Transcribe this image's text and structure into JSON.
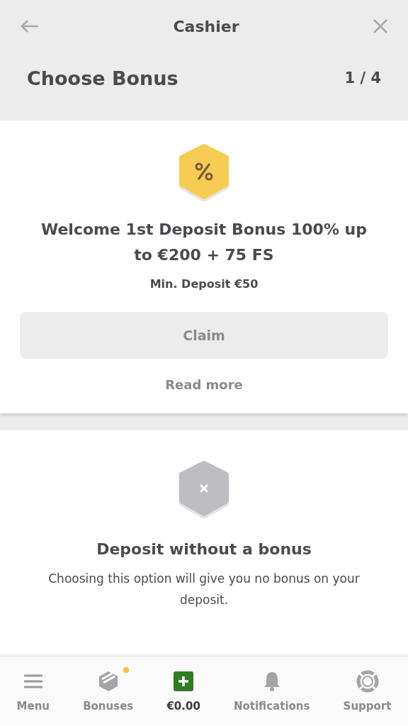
{
  "header": {
    "title": "Cashier",
    "heading": "Choose Bonus",
    "step": "1 / 4"
  },
  "options": [
    {
      "kind": "bonus",
      "title": "Welcome 1st Deposit Bonus 100% up to €200 + 75 FS",
      "subtitle": "Min. Deposit €50",
      "button": {
        "label": "Claim",
        "disabled": true
      },
      "link": "Read more"
    },
    {
      "kind": "none",
      "title": "Deposit without a bonus",
      "subtitle": "Choosing this option will give you no bonus on your deposit."
    }
  ],
  "nav": [
    {
      "label": "Menu",
      "badge": false,
      "selected": false
    },
    {
      "label": "Bonuses",
      "badge": true,
      "selected": false
    },
    {
      "label": "€0.00",
      "badge": false,
      "selected": true
    },
    {
      "label": "Notifications",
      "badge": false,
      "selected": false
    },
    {
      "label": "Support",
      "badge": false,
      "selected": false
    }
  ]
}
